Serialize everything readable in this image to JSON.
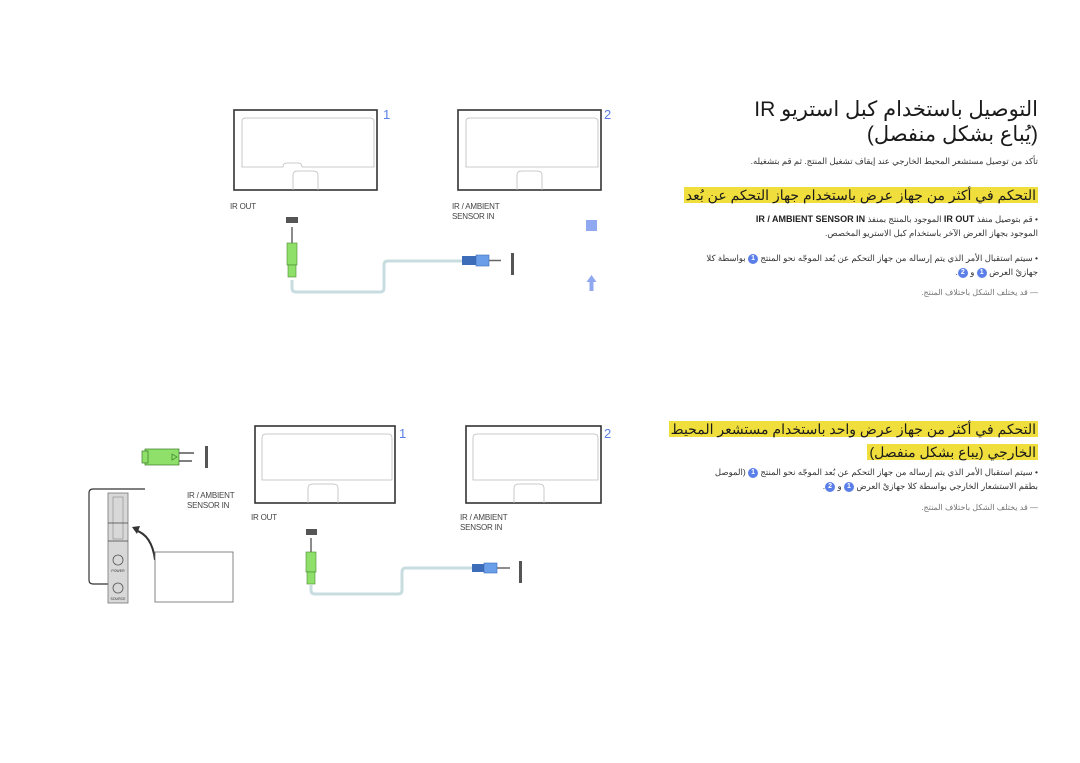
{
  "section1": {
    "title_line1": "التوصيل باستخدام كبل استريو IR",
    "title_line2": "(يُباع بشكل منفصل)",
    "intro": "تأكد من توصيل مستشعر المحيط الخارجي عند إيقاف تشغيل المنتج. ثم قم بتشغيله.",
    "heading": "التحكم في أكثر من جهاز عرض باستخدام جهاز التحكم عن بُعد",
    "bullet1_prefix": "• قم بتوصيل منفذ",
    "bullet1_port_out": "IR OUT",
    "bullet1_mid": "الموجود بالمنتج بمنفذ",
    "bullet1_port_in": "IR / AMBIENT SENSOR IN",
    "bullet1_line2": "الموجود بجهاز العرض الآخر باستخدام كبل الاستريو المخصص.",
    "bullet2_line1a": "• سيتم استقبال الأمر الذي يتم إرساله من جهاز التحكم عن بُعد الموجّه نحو المنتج",
    "bullet2_line1b": "بواسطة كلا",
    "bullet2_line2a": "جهازيْ العرض",
    "bullet2_and": "و",
    "badge1": "1",
    "badge2": "2",
    "note": "― قد يختلف الشكل باختلاف المنتج."
  },
  "section2": {
    "heading_line1": "التحكم في أكثر من جهاز عرض واحد باستخدام مستشعر المحيط",
    "heading_line2": "الخارجي (يباع بشكل منفصل)",
    "bullet_line1a": "• سيتم استقبال الأمر الذي يتم إرساله من جهاز التحكم عن بُعد الموجّه نحو المنتج",
    "bullet_line1b": "(الموصل",
    "bullet_line2a": "بطقم الاستشعار الخارجي بواسطة كلا جهازيْ العرض",
    "bullet_and": "و",
    "badge1": "1",
    "badge2": "2",
    "note": "― قد يختلف الشكل باختلاف المنتج."
  },
  "diagram1": {
    "display1_number": "1",
    "display2_number": "2",
    "ir_out_label": "IR OUT",
    "sensor_in_label_line1": "IR / AMBIENT",
    "sensor_in_label_line2": "SENSOR IN"
  },
  "diagram2": {
    "display1_number": "1",
    "display2_number": "2",
    "ir_out_label": "IR OUT",
    "sensor_in_label_line1": "IR / AMBIENT",
    "sensor_in_label_line2": "SENSOR IN",
    "sensor_kit_label_line1": "IR / AMBIENT",
    "sensor_kit_label_line2": "SENSOR IN",
    "power_label": "POWER",
    "source_label": "SOURCE"
  },
  "colors": {
    "highlight": "#f0de3c",
    "accent_blue": "#5b7fe8",
    "cable_green": "#8ee06a",
    "cable_blue": "#6a9ee8"
  }
}
